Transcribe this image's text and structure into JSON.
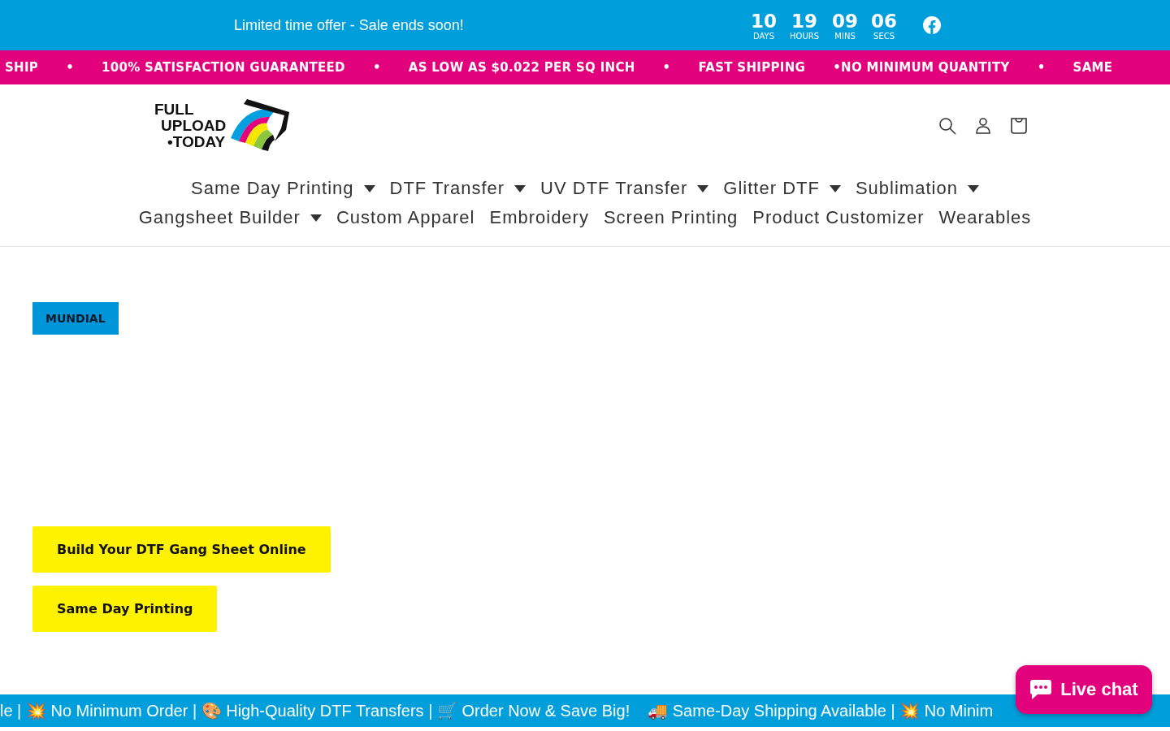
{
  "announcement": {
    "message": "Limited time offer - Sale ends soon!",
    "countdown": [
      {
        "value": "10",
        "unit": "DAYS"
      },
      {
        "value": "19",
        "unit": "HOURS"
      },
      {
        "value": "09",
        "unit": "MINS"
      },
      {
        "value": "06",
        "unit": "SECS"
      }
    ]
  },
  "ticker": [
    "SHIP",
    "•",
    "100% SATISFACTION GUARANTEED",
    "•",
    "AS LOW AS $0.022 PER SQ INCH",
    "•",
    "FAST SHIPPING",
    "•NO MINIMUM QUANTITY",
    "•",
    "SAME"
  ],
  "logo": {
    "lines": [
      "FULL",
      "UPLOAD",
      "•TODAY"
    ]
  },
  "nav": [
    [
      {
        "label": "Same Day Printing",
        "has_menu": true
      },
      {
        "label": "DTF Transfer",
        "has_menu": true
      },
      {
        "label": "UV DTF Transfer",
        "has_menu": true
      },
      {
        "label": "Glitter DTF",
        "has_menu": true
      },
      {
        "label": "Sublimation",
        "has_menu": true
      }
    ],
    [
      {
        "label": "Gangsheet Builder",
        "has_menu": true
      },
      {
        "label": "Custom Apparel",
        "has_menu": false
      },
      {
        "label": "Embroidery",
        "has_menu": false
      },
      {
        "label": "Screen Printing",
        "has_menu": false
      },
      {
        "label": "Product Customizer",
        "has_menu": false
      },
      {
        "label": "Wearables",
        "has_menu": false
      }
    ]
  ],
  "badge": "MUNDIAL",
  "buttons": [
    "Build Your DTF Gang Sheet Online",
    "Same Day Printing"
  ],
  "bottom_ticker": [
    "le | 💥 No Minimum Order | 🎨 High-Quality DTF Transfers | 🛒 Order Now & Save Big!",
    "🚚 Same-Day Shipping Available | 💥 No Minim"
  ],
  "live_chat": "Live chat"
}
